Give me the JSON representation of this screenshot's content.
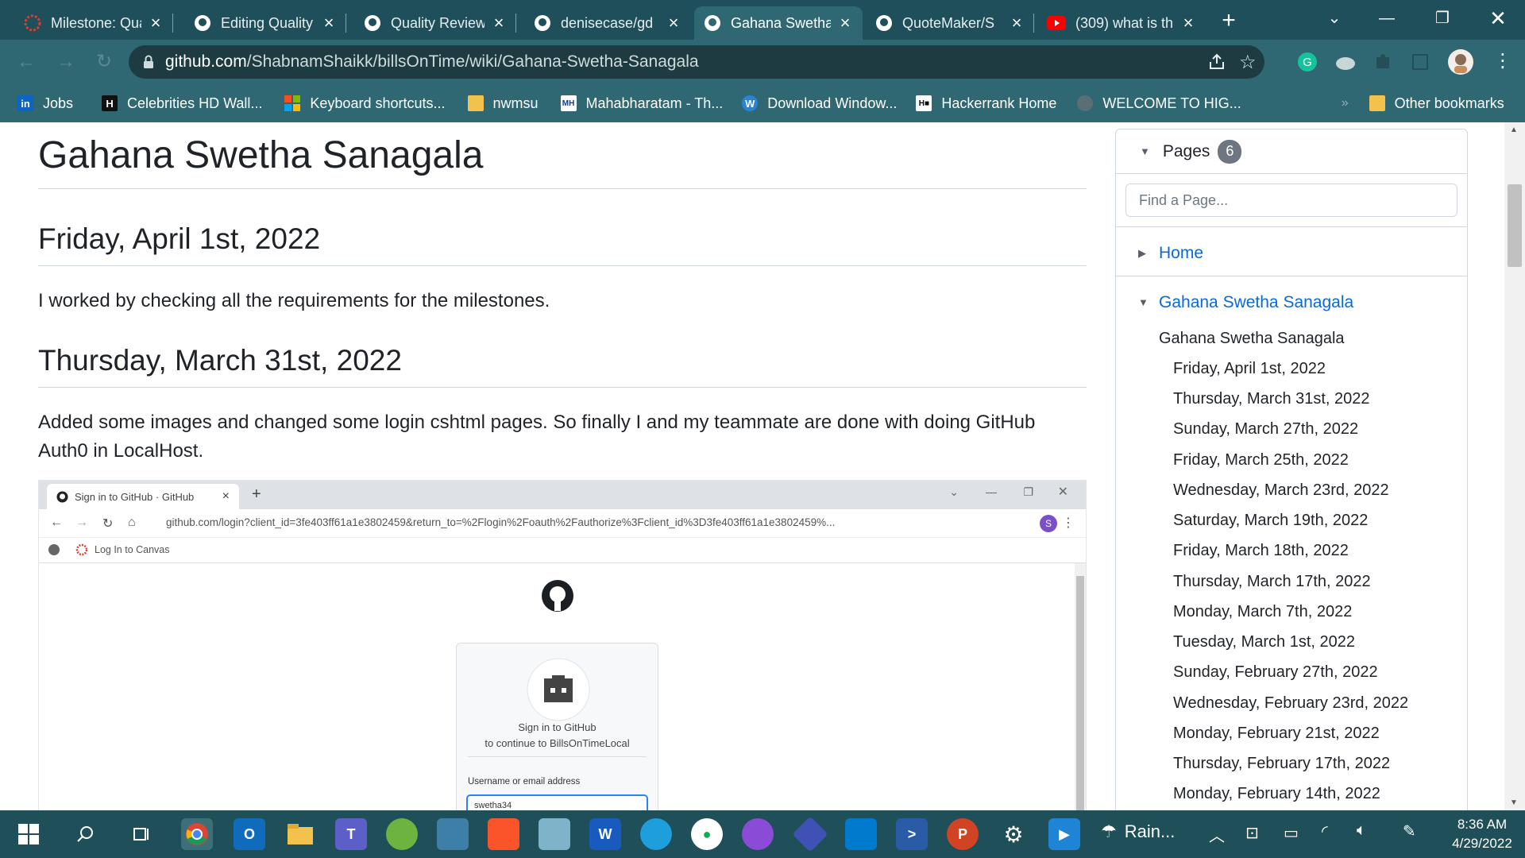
{
  "tabs": [
    {
      "title": "Milestone: Qua",
      "icon": "canvas-icon",
      "active": false
    },
    {
      "title": "Editing Quality",
      "icon": "github-icon",
      "active": false
    },
    {
      "title": "Quality Review",
      "icon": "github-icon",
      "active": false
    },
    {
      "title": "denisecase/gd",
      "icon": "github-icon",
      "active": false
    },
    {
      "title": "Gahana Swetha",
      "icon": "github-icon",
      "active": true
    },
    {
      "title": "QuoteMaker/S",
      "icon": "github-icon",
      "active": false
    },
    {
      "title": "(309) what is th",
      "icon": "youtube-icon",
      "active": false
    }
  ],
  "address": {
    "domain": "github.com",
    "path": "/ShabnamShaikk/billsOnTime/wiki/Gahana-Swetha-Sanagala"
  },
  "bookmarks": [
    "Jobs",
    "Celebrities HD Wall...",
    "Keyboard shortcuts...",
    "nwmsu",
    "Mahabharatam - Th...",
    "Download Window...",
    "Hackerrank Home",
    "WELCOME TO HIG...",
    "Other bookmarks"
  ],
  "page": {
    "title": "Gahana Swetha Sanagala",
    "sections": [
      {
        "heading": "Friday, April 1st, 2022",
        "text": "I worked by checking all the requirements for the milestones."
      },
      {
        "heading": "Thursday, March 31st, 2022",
        "text": "Added some images and changed some login cshtml pages. So finally I and my teammate are done with doing GitHub Auth0 in LocalHost."
      }
    ]
  },
  "embedded_screenshot": {
    "tab_title": "Sign in to GitHub · GitHub",
    "url": "github.com/login?client_id=3fe403ff61a1e3802459&return_to=%2Flogin%2Foauth%2Fauthorize%3Fclient_id%3D3fe403ff61a1e3802459%...",
    "bookmark": "Log In to Canvas",
    "avatar_letter": "S",
    "sign_in_line1": "Sign in to GitHub",
    "sign_in_line2": "to continue to BillsOnTimeLocal",
    "username_label": "Username or email address",
    "username_value": "swetha34"
  },
  "sidebar": {
    "pages_label": "Pages",
    "pages_count": "6",
    "find_placeholder": "Find a Page...",
    "home_link": "Home",
    "current_link": "Gahana Swetha Sanagala",
    "current_sub": "Gahana Swetha Sanagala",
    "toc": [
      "Friday, April 1st, 2022",
      "Thursday, March 31st, 2022",
      "Sunday, March 27th, 2022",
      "Friday, March 25th, 2022",
      "Wednesday, March 23rd, 2022",
      "Saturday, March 19th, 2022",
      "Friday, March 18th, 2022",
      "Thursday, March 17th, 2022",
      "Monday, March 7th, 2022",
      "Tuesday, March 1st, 2022",
      "Sunday, February 27th, 2022",
      "Wednesday, February 23rd, 2022",
      "Monday, February 21st, 2022",
      "Thursday, February 17th, 2022",
      "Monday, February 14th, 2022"
    ]
  },
  "taskbar": {
    "weather": "Rain...",
    "time": "8:36 AM",
    "date": "4/29/2022"
  },
  "colors": {
    "chrome_frame": "#1e4f5a",
    "chrome_toolbar": "#2f6873",
    "link_blue": "#0969da",
    "taskbar": "#1f4f58"
  }
}
